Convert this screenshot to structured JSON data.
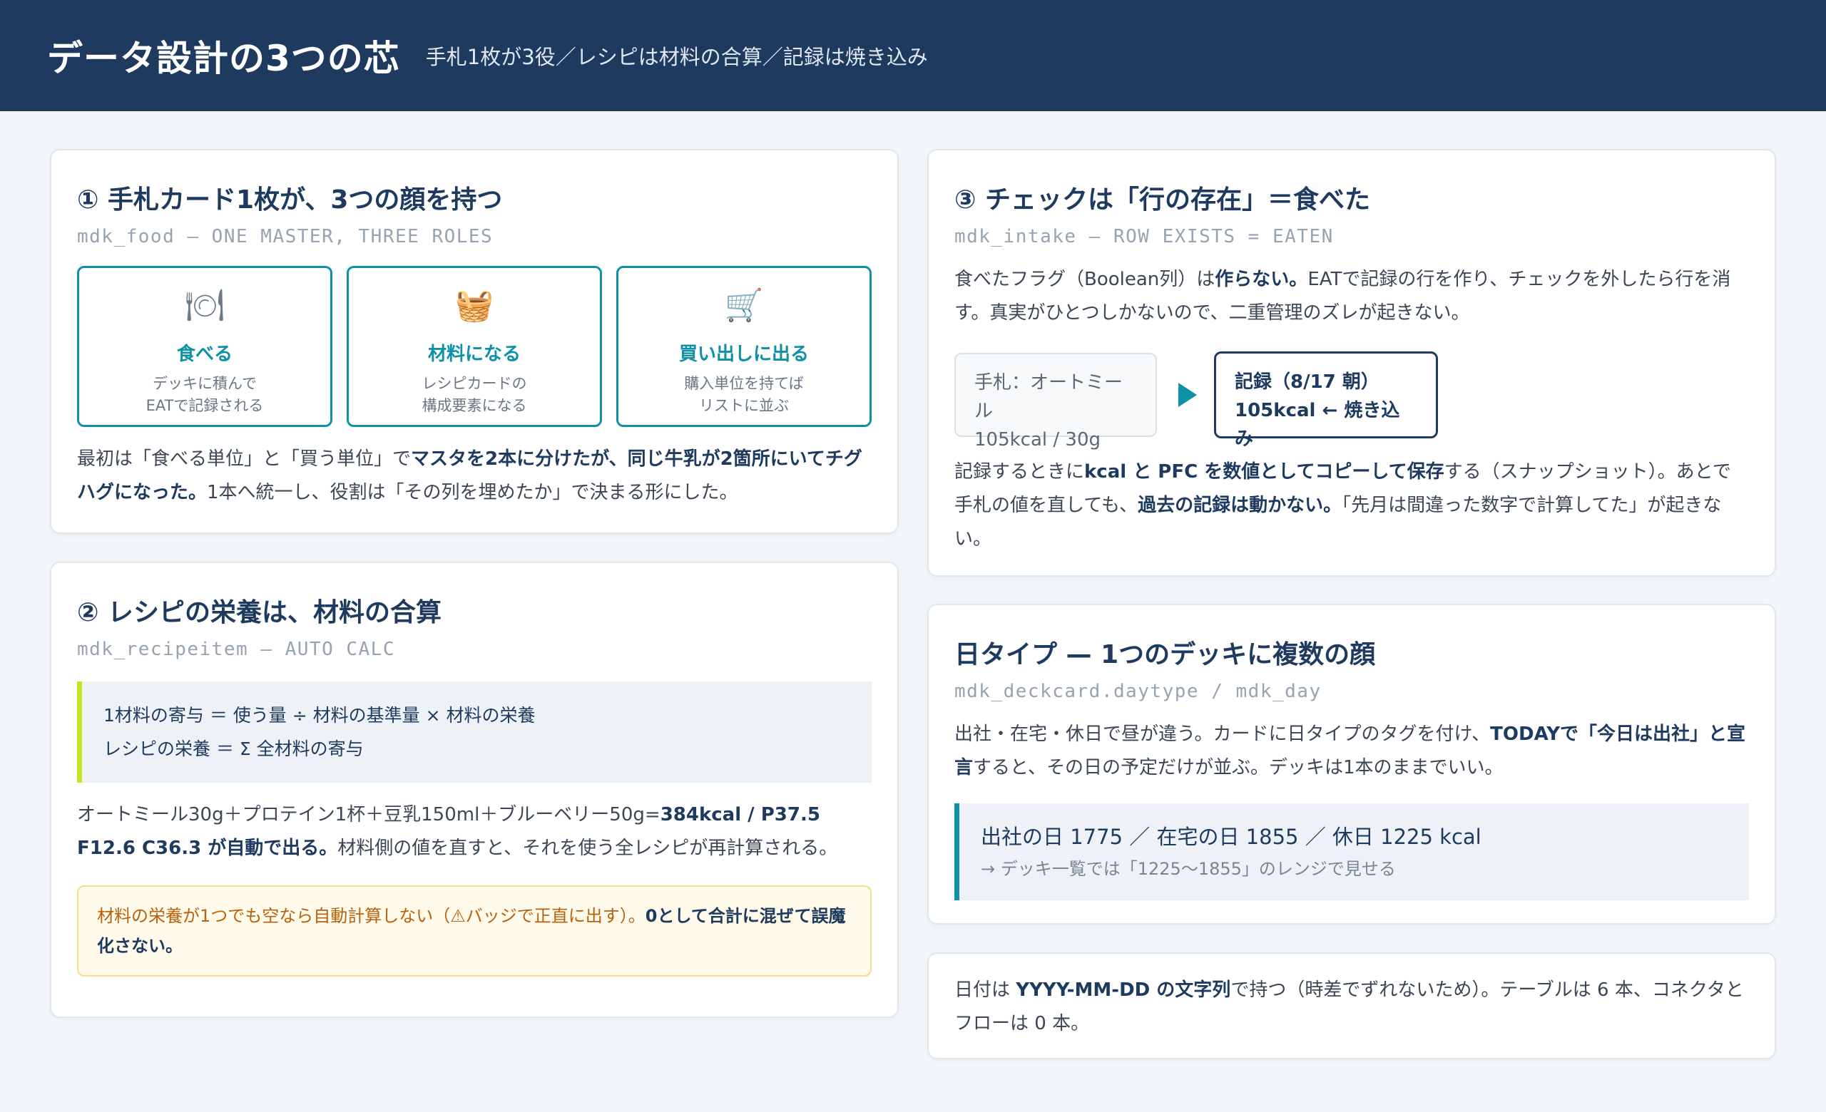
{
  "header": {
    "title": "データ設計の3つの芯",
    "subtitle": "手札1枚が3役／レシピは材料の合算／記録は焼き込み"
  },
  "card1": {
    "title": "① 手札カード1枚が、3つの顔を持つ",
    "code": "mdk_food — ONE MASTER, THREE ROLES",
    "roles": [
      {
        "icon": "plate-icon",
        "glyph": "🍽",
        "name": "食べる",
        "desc1": "デッキに積んで",
        "desc2": "EATで記録される"
      },
      {
        "icon": "basket-icon",
        "glyph": "🧺",
        "name": "材料になる",
        "desc1": "レシピカードの",
        "desc2": "構成要素になる"
      },
      {
        "icon": "cart-icon",
        "glyph": "🛒",
        "name": "買い出しに出る",
        "desc1": "購入単位を持てば",
        "desc2": "リストに並ぶ"
      }
    ],
    "p_a": "最初は「食べる単位」と「買う単位」で",
    "p_b": "マスタを2本に分けたが、同じ牛乳が2箇所にいてチグハグになった。",
    "p_c": "1本へ統一し、役割は「その列を埋めたか」で決まる形にした。"
  },
  "card2": {
    "title": "② レシピの栄養は、材料の合算",
    "code": "mdk_recipeitem — AUTO CALC",
    "formula1": "1材料の寄与 ＝ 使う量 ÷ 材料の基準量 × 材料の栄養",
    "formula2": "レシピの栄養 ＝ Σ 全材料の寄与",
    "p_a": "オートミール30g＋プロテイン1杯＋豆乳150ml＋ブルーベリー50g=",
    "p_b": "384kcal / P37.5 F12.6 C36.3 が自動で出る。",
    "p_c": "材料側の値を直すと、それを使う全レシピが再計算される。",
    "warn_a": "材料の栄養が1つでも空なら自動計算しない（⚠バッジで正直に出す）。",
    "warn_b": "0として合計に混ぜて誤魔化さない。"
  },
  "card3": {
    "title": "③ チェックは「行の存在」＝食べた",
    "code": "mdk_intake — ROW EXISTS = EATEN",
    "p1_a": "食べたフラグ（Boolean列）は",
    "p1_b": "作らない。",
    "p1_c": "EATで記録の行を作り、チェックを外したら行を消す。真実がひとつしかないので、二重管理のズレが起きない。",
    "flow_a1": "手札：オートミール",
    "flow_a2": "105kcal / 30g",
    "flow_b1": "記録（8/17 朝）",
    "flow_b2": "105kcal ← 焼き込み",
    "p2_a": "記録するときに",
    "p2_b": "kcal と PFC を数値としてコピーして保存",
    "p2_c": "する（スナップショット）。あとで手札の値を直しても、",
    "p2_d": "過去の記録は動かない。",
    "p2_e": "「先月は間違った数字で計算してた」が起きない。"
  },
  "card4": {
    "title": "日タイプ — 1つのデッキに複数の顔",
    "code": "mdk_deckcard.daytype / mdk_day",
    "p_a": "出社・在宅・休日で昼が違う。カードに日タイプのタグを付け、",
    "p_b": "TODAYで「今日は出社」と宣言",
    "p_c": "すると、その日の予定だけが並ぶ。デッキは1本のままでいい。",
    "box_main": "出社の日 1775 ／ 在宅の日 1855 ／ 休日 1225 kcal",
    "box_note": "→ デッキ一覧では「1225〜1855」のレンジで見せる"
  },
  "card5": {
    "p_a": "日付は ",
    "p_b": "YYYY-MM-DD の文字列",
    "p_c": "で持つ（時差でずれないため）。テーブルは 6 本、コネクタとフローは 0 本。"
  }
}
